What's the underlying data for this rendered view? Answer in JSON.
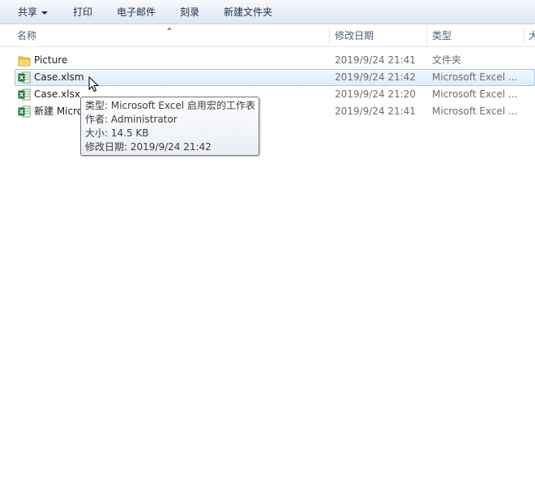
{
  "toolbar": {
    "share": "共享",
    "print": "打印",
    "email": "电子邮件",
    "burn": "刻录",
    "new_folder": "新建文件夹"
  },
  "columns": {
    "name": "名称",
    "modified": "修改日期",
    "type": "类型",
    "size": "大"
  },
  "files": [
    {
      "name": "Picture",
      "modified": "2019/9/24 21:41",
      "type": "文件夹",
      "icon": "folder-icon"
    },
    {
      "name": "Case.xlsm",
      "modified": "2019/9/24 21:42",
      "type": "Microsoft Excel ...",
      "icon": "excel-icon",
      "selected": true
    },
    {
      "name": "Case.xlsx",
      "modified": "2019/9/24 21:20",
      "type": "Microsoft Excel ...",
      "icon": "excel-icon"
    },
    {
      "name": "新建 Micro",
      "modified": "2019/9/24 21:41",
      "type": "Microsoft Excel ...",
      "icon": "excel-icon"
    }
  ],
  "tooltip": {
    "type_line": "类型: Microsoft Excel 启用宏的工作表",
    "author_line": "作者: Administrator",
    "size_line": "大小: 14.5 KB",
    "modified_line": "修改日期: 2019/9/24 21:42"
  },
  "colors": {
    "selection_border": "#a9c7ea",
    "excel_green": "#1f7a3a",
    "folder_yellow": "#f3c94b"
  }
}
